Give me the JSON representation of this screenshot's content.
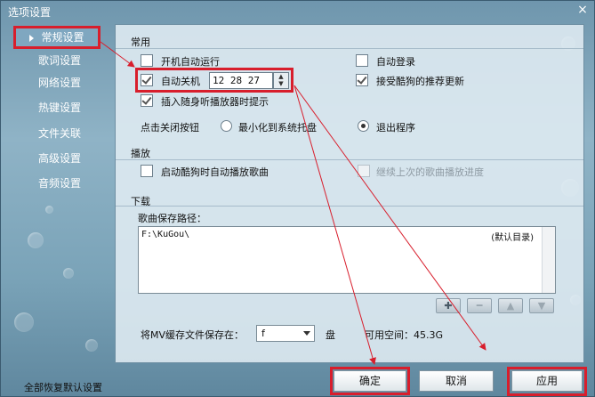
{
  "window": {
    "title": "选项设置",
    "close_label": "×"
  },
  "sidebar": {
    "items": [
      {
        "label": "常规设置"
      },
      {
        "label": "歌词设置"
      },
      {
        "label": "网络设置"
      },
      {
        "label": "热键设置"
      },
      {
        "label": "文件关联"
      },
      {
        "label": "高级设置"
      },
      {
        "label": "音频设置"
      }
    ]
  },
  "general": {
    "section_title": "常用",
    "autostart_label": "开机自动运行",
    "autologin_label": "自动登录",
    "autoshutdown_label": "自动关机",
    "shutdown_time": "12 28 27",
    "recommend_label": "接受酷狗的推荐更新",
    "insert_play_label": "插入随身听播放器时提示",
    "close_btn_label": "点击关闭按钮",
    "minimize_label": "最小化到系统托盘",
    "exit_label": "退出程序"
  },
  "playback": {
    "section_title": "播放",
    "autoplay_label": "启动酷狗时自动播放歌曲",
    "resume_label": "继续上次的歌曲播放进度"
  },
  "download": {
    "section_title": "下载",
    "path_label": "歌曲保存路径：",
    "path_value": "F:\\KuGou\\",
    "path_default": "(默认目录)",
    "add_btn": "✚",
    "remove_btn": "━",
    "up_btn": "▲",
    "down_btn": "▼",
    "mv_label": "将MV缓存文件保存在：",
    "drive_value": "f",
    "drive_unit": "盘",
    "free_space": "可用空间：45.3G"
  },
  "footer": {
    "restore_label": "全部恢复默认设置",
    "ok_label": "确定",
    "cancel_label": "取消",
    "apply_label": "应用"
  },
  "colors": {
    "highlight": "#d81e2c",
    "panel": "#e0ecf3",
    "background": "#7aa3b8"
  }
}
